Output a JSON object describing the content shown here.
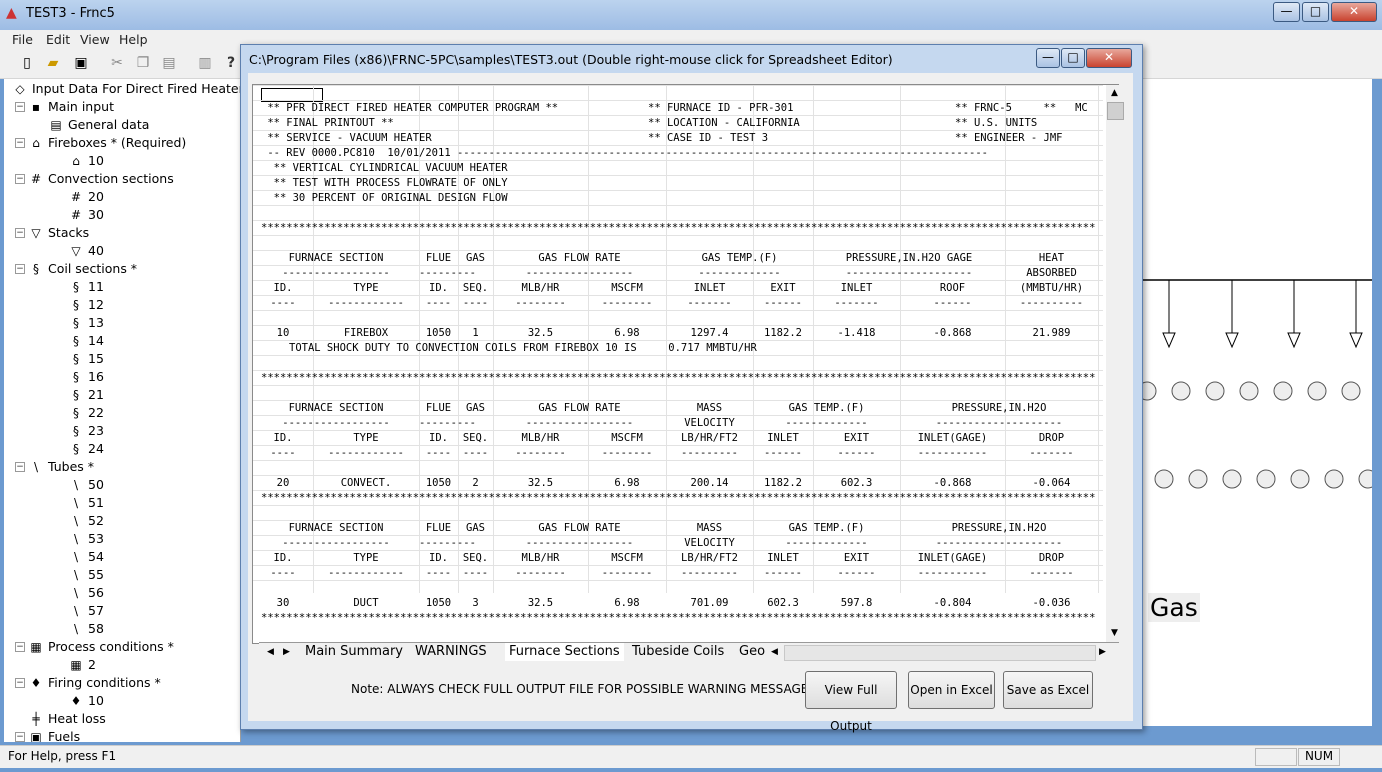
{
  "app": {
    "title": "TEST3 - Frnc5",
    "minimize": "—",
    "maximize": "□",
    "close": "✕"
  },
  "menu": [
    "File",
    "Edit",
    "View",
    "Help"
  ],
  "tree": {
    "items": [
      {
        "label": "Input Data For Direct Fired Heater",
        "icon": "◇"
      },
      {
        "label": "Main input",
        "icon": "▪"
      },
      {
        "label": "General data",
        "icon": "▤"
      },
      {
        "label": "Fireboxes * (Required)",
        "icon": "⌂"
      },
      {
        "label": "10",
        "icon": "⌂"
      },
      {
        "label": "Convection sections",
        "icon": "#"
      },
      {
        "label": "20",
        "icon": "#"
      },
      {
        "label": "30",
        "icon": "#"
      },
      {
        "label": "Stacks",
        "icon": "▽"
      },
      {
        "label": "40",
        "icon": "▽"
      },
      {
        "label": "Coil sections *",
        "icon": "§"
      },
      {
        "label": "11",
        "icon": "§"
      },
      {
        "label": "12",
        "icon": "§"
      },
      {
        "label": "13",
        "icon": "§"
      },
      {
        "label": "14",
        "icon": "§"
      },
      {
        "label": "15",
        "icon": "§"
      },
      {
        "label": "16",
        "icon": "§"
      },
      {
        "label": "21",
        "icon": "§"
      },
      {
        "label": "22",
        "icon": "§"
      },
      {
        "label": "23",
        "icon": "§"
      },
      {
        "label": "24",
        "icon": "§"
      },
      {
        "label": "Tubes *",
        "icon": "\\"
      },
      {
        "label": "50",
        "icon": "\\"
      },
      {
        "label": "51",
        "icon": "\\"
      },
      {
        "label": "52",
        "icon": "\\"
      },
      {
        "label": "53",
        "icon": "\\"
      },
      {
        "label": "54",
        "icon": "\\"
      },
      {
        "label": "55",
        "icon": "\\"
      },
      {
        "label": "56",
        "icon": "\\"
      },
      {
        "label": "57",
        "icon": "\\"
      },
      {
        "label": "58",
        "icon": "\\"
      },
      {
        "label": "Process conditions *",
        "icon": "▦"
      },
      {
        "label": "2",
        "icon": "▦"
      },
      {
        "label": "Firing conditions *",
        "icon": "♦"
      },
      {
        "label": "10",
        "icon": "♦"
      },
      {
        "label": "Heat loss",
        "icon": "╪"
      },
      {
        "label": "Fuels",
        "icon": "▣"
      }
    ]
  },
  "child": {
    "title": "C:\\Program Files (x86)\\FRNC-5PC\\samples\\TEST3.out       (Double right-mouse click for Spreadsheet Editor)",
    "report_header": [
      " ** PFR DIRECT FIRED HEATER COMPUTER PROGRAM **",
      " ** FINAL PRINTOUT **",
      " ** SERVICE - VACUUM HEATER",
      " -- REV 0000.PC810  10/01/2011 ------------------------------------------------------------------------------------",
      "  ** VERTICAL CYLINDRICAL VACUUM HEATER",
      "  ** TEST WITH PROCESS FLOWRATE OF ONLY",
      "  ** 30 PERCENT OF ORIGINAL DESIGN FLOW"
    ],
    "header_mid": [
      "** FURNACE ID - PFR-301",
      "** LOCATION - CALIFORNIA",
      "** CASE ID - TEST 3"
    ],
    "header_right": [
      "** FRNC-5     **   MC",
      "** U.S. UNITS",
      "** ENGINEER - JMF"
    ],
    "stars": "************************************************************************************************************************************",
    "sec1": {
      "h1": [
        "FURNACE SECTION",
        "FLUE",
        "GAS",
        "GAS FLOW RATE",
        "GAS TEMP.(F)",
        "PRESSURE,IN.H2O GAGE",
        "HEAT"
      ],
      "h1b": [
        "-----------------",
        "---------",
        "",
        "-----------------",
        "-------------",
        "--------------------",
        "ABSORBED"
      ],
      "h2": [
        "ID.",
        "TYPE",
        "ID.",
        "SEQ.",
        "MLB/HR",
        "MSCFM",
        "INLET",
        "EXIT",
        "INLET",
        "ROOF",
        "(MMBTU/HR)"
      ],
      "h2b": [
        "----",
        "------------",
        "----",
        "----",
        "--------",
        "--------",
        "-------",
        "------",
        "-------",
        "------",
        "----------"
      ],
      "row": [
        "10",
        "FIREBOX",
        "1050",
        "1",
        "32.5",
        "6.98",
        "1297.4",
        "1182.2",
        "-1.418",
        "-0.868",
        "21.989"
      ],
      "shock": "TOTAL SHOCK DUTY TO CONVECTION COILS FROM FIREBOX 10 IS     0.717 MMBTU/HR"
    },
    "sec2": {
      "h1": [
        "FURNACE SECTION",
        "FLUE",
        "GAS",
        "GAS FLOW RATE",
        "MASS",
        "GAS TEMP.(F)",
        "PRESSURE,IN.H2O"
      ],
      "h1b": [
        "-----------------",
        "---------",
        "",
        "-----------------",
        "VELOCITY",
        "-------------",
        "--------------------"
      ],
      "h2": [
        "ID.",
        "TYPE",
        "ID.",
        "SEQ.",
        "MLB/HR",
        "MSCFM",
        "LB/HR/FT2",
        "INLET",
        "EXIT",
        "INLET(GAGE)",
        "DROP"
      ],
      "h2b": [
        "----",
        "------------",
        "----",
        "----",
        "--------",
        "--------",
        "---------",
        "------",
        "------",
        "-----------",
        "-------"
      ],
      "row": [
        "20",
        "CONVECT.",
        "1050",
        "2",
        "32.5",
        "6.98",
        "200.14",
        "1182.2",
        "602.3",
        "-0.868",
        "-0.064"
      ]
    },
    "sec3": {
      "h1": [
        "FURNACE SECTION",
        "FLUE",
        "GAS",
        "GAS FLOW RATE",
        "MASS",
        "GAS TEMP.(F)",
        "PRESSURE,IN.H2O"
      ],
      "h1b": [
        "-----------------",
        "---------",
        "",
        "-----------------",
        "VELOCITY",
        "-------------",
        "--------------------"
      ],
      "h2": [
        "ID.",
        "TYPE",
        "ID.",
        "SEQ.",
        "MLB/HR",
        "MSCFM",
        "LB/HR/FT2",
        "INLET",
        "EXIT",
        "INLET(GAGE)",
        "DROP"
      ],
      "h2b": [
        "----",
        "------------",
        "----",
        "----",
        "--------",
        "--------",
        "---------",
        "------",
        "------",
        "-----------",
        "-------"
      ],
      "row": [
        "30",
        "DUCT",
        "1050",
        "3",
        "32.5",
        "6.98",
        "701.09",
        "602.3",
        "597.8",
        "-0.804",
        "-0.036"
      ]
    },
    "tabs": [
      "Main Summary",
      "WARNINGS",
      "Furnace Sections",
      "Tubeside Coils",
      "Geo"
    ],
    "note": "Note:  ALWAYS CHECK FULL OUTPUT FILE FOR POSSIBLE WARNING MESSAGES.",
    "buttons": {
      "view_full": "View Full Output",
      "open_excel": "Open in Excel",
      "save_excel": "Save as Excel"
    }
  },
  "right": {
    "gas_label": "Gas"
  },
  "status": {
    "help": "For Help, press F1",
    "num": "NUM"
  }
}
